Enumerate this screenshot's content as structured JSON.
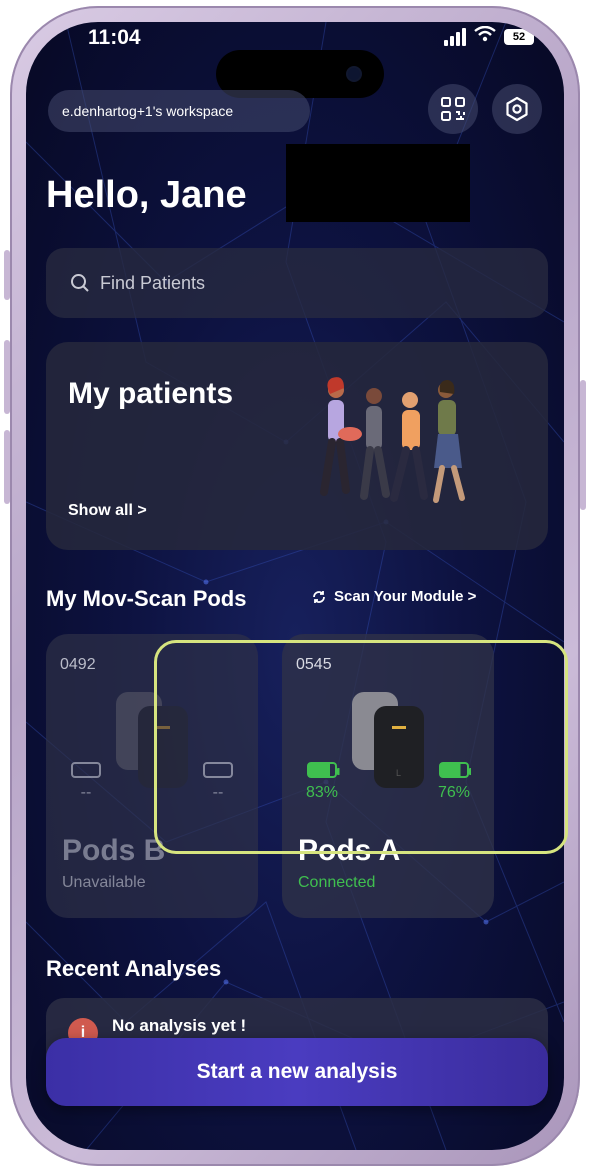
{
  "status_bar": {
    "time": "11:04",
    "battery": "52"
  },
  "header": {
    "workspace": "e.denhartog+1's workspace",
    "qr_icon": "qr-code-icon",
    "settings_icon": "settings-icon"
  },
  "greeting": "Hello, Jane",
  "search": {
    "placeholder": "Find Patients"
  },
  "patients_card": {
    "title": "My patients",
    "link": "Show all >"
  },
  "pods_section": {
    "title": "My Mov-Scan Pods",
    "scan_link": "Scan Your Module >"
  },
  "pods": [
    {
      "id": "0492",
      "name": "Pods B",
      "status": "Unavailable",
      "left_battery": "--",
      "right_battery": "--"
    },
    {
      "id": "0545",
      "name": "Pods A",
      "status": "Connected",
      "left_battery": "83%",
      "right_battery": "76%"
    }
  ],
  "recent": {
    "title": "Recent Analyses",
    "empty_message": "No analysis yet !"
  },
  "cta": {
    "label": "Start a new analysis"
  },
  "colors": {
    "accent": "#4a3cc0",
    "connected": "#3fbf4f",
    "highlight": "#d6e47f",
    "warning": "#d05a4f"
  }
}
